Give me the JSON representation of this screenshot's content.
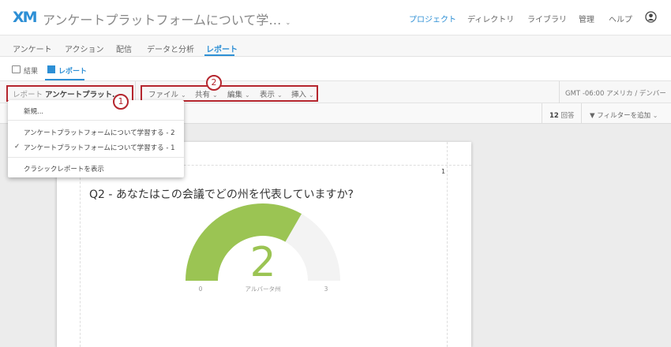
{
  "header": {
    "logo": "XM",
    "title": "アンケートプラットフォームについて学…",
    "title_chevron": "⌄",
    "nav": [
      "プロジェクト",
      "ディレクトリ",
      "ライブラリ",
      "管理",
      "ヘルプ"
    ]
  },
  "tabs": [
    "アンケート",
    "アクション",
    "配信",
    "データと分析",
    "レポート"
  ],
  "subtabs": [
    "結果",
    "レポート"
  ],
  "toolbar": {
    "report_prefix": "レポート",
    "report_name": "アンケートプラット…",
    "menus": [
      "ファイル",
      "共有",
      "編集",
      "表示",
      "挿入"
    ],
    "timezone": "GMT -06:00 アメリカ / デンバー"
  },
  "callouts": [
    "1",
    "2"
  ],
  "filterbar": {
    "count": "12",
    "count_label": "回答",
    "add_filter": "フィルターを追加"
  },
  "dropdown": {
    "new": "新規...",
    "items": [
      "アンケートプラットフォームについて学習する - 2",
      "アンケートプラットフォームについて学習する - 1"
    ],
    "checked_index": 1,
    "classic": "クラシックレポートを表示"
  },
  "report": {
    "page_number": "1",
    "question": "Q2 - あなたはこの会議でどの州を代表していますか?"
  },
  "colors": {
    "accent": "#2d8fd5",
    "gauge_fill": "#9bc453",
    "gauge_bg": "#f3f3f3",
    "callout": "#b5262e"
  },
  "chart_data": {
    "type": "gauge",
    "value": 2,
    "min": 0,
    "max": 3,
    "value_label": "2",
    "category_label": "アルバータ州",
    "min_label": "0",
    "max_label": "3"
  }
}
